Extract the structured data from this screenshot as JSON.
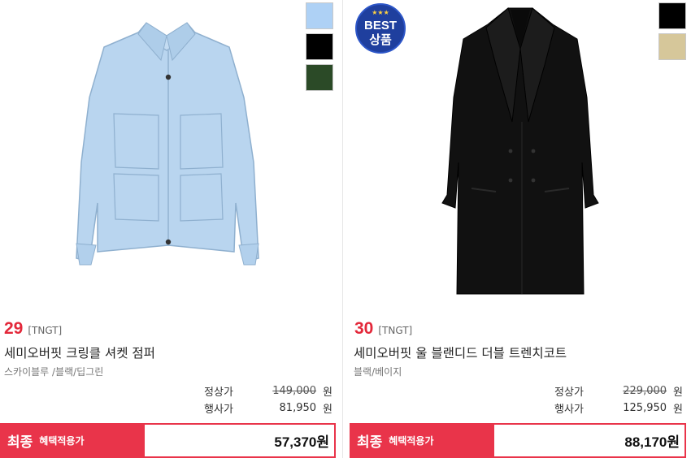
{
  "products": [
    {
      "rank": "29",
      "brand": "[TNGT]",
      "name": "세미오버핏 크링클 셔켓 점퍼",
      "colors": "스카이블루 /블랙/딥그린",
      "regular_label": "정상가",
      "regular_price": "149,000",
      "event_label": "행사가",
      "event_price": "81,950",
      "currency": "원",
      "final_label": "최종",
      "final_sublabel": "혜택적용가",
      "final_price": "57,370원",
      "swatch_colors": [
        "#aed1f5",
        "#000000",
        "#2b4a27"
      ],
      "image_icon": "light-blue-jacket-image"
    },
    {
      "rank": "30",
      "brand": "[TNGT]",
      "name": "세미오버핏 울 블랜디드 더블 트렌치코트",
      "colors": "블랙/베이지",
      "regular_label": "정상가",
      "regular_price": "229,000",
      "event_label": "행사가",
      "event_price": "125,950",
      "currency": "원",
      "final_label": "최종",
      "final_sublabel": "혜택적용가",
      "final_price": "88,170원",
      "swatch_colors": [
        "#000000",
        "#d6c79a"
      ],
      "badge_line1": "BEST",
      "badge_line2": "상품",
      "image_icon": "black-coat-image"
    }
  ],
  "accent_color": "#e9344a"
}
